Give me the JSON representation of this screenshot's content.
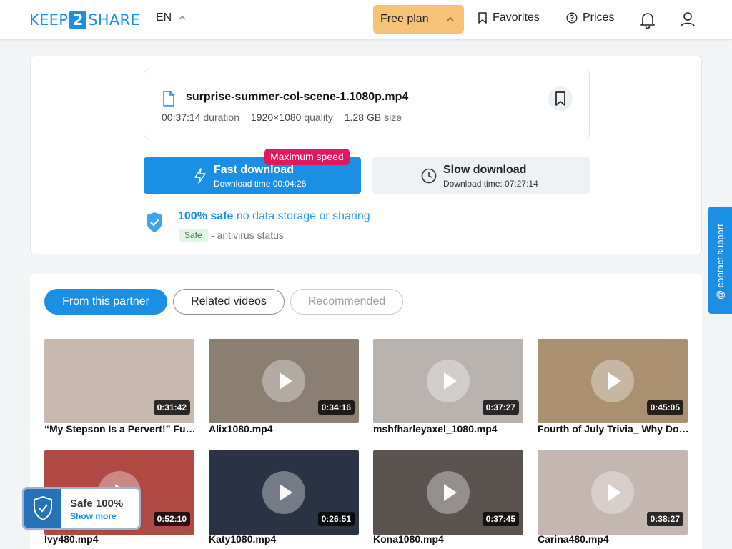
{
  "header": {
    "logo_pre": "KEEP",
    "logo_num": "2",
    "logo_post": "SHARE",
    "lang": "EN",
    "plan": "Free plan",
    "favorites": "Favorites",
    "prices": "Prices"
  },
  "file": {
    "name": "surprise-summer-col-scene-1.1080p.mp4",
    "duration_val": "00:37:14",
    "duration_label": "duration",
    "quality_val": "1920×1080",
    "quality_label": "quality",
    "size_val": "1.28 GB",
    "size_label": "size"
  },
  "download": {
    "fast_title": "Fast download",
    "fast_sub": "Download time 00:04:28",
    "badge": "Maximum speed",
    "slow_title": "Slow download",
    "slow_sub": "Download time: 07:27:14"
  },
  "safety": {
    "strong": "100% safe",
    "light": "no data storage or sharing",
    "tag": "Safe",
    "desc": "- antivirus status"
  },
  "tabs": [
    "From this partner",
    "Related videos",
    "Recommended"
  ],
  "videos": [
    {
      "title": "“My Stepson Is a Pervert!” Fuc…",
      "duration": "0:31:42",
      "bg": "#c9b8b0",
      "play": false
    },
    {
      "title": "Alix1080.mp4",
      "duration": "0:34:16",
      "bg": "#8a7f70",
      "play": true
    },
    {
      "title": "mshfharleyaxel_1080.mp4",
      "duration": "0:37:27",
      "bg": "#b9b3b0",
      "play": true
    },
    {
      "title": "Fourth of July Trivia_ Why Do Y…",
      "duration": "0:45:05",
      "bg": "#a89070",
      "play": true
    },
    {
      "title": "Ivy480.mp4",
      "duration": "0:52:10",
      "bg": "#b04a44",
      "play": true
    },
    {
      "title": "Katy1080.mp4",
      "duration": "0:26:51",
      "bg": "#2a3346",
      "play": true
    },
    {
      "title": "Kona1080.mp4",
      "duration": "0:37:45",
      "bg": "#5b5350",
      "play": true
    },
    {
      "title": "Carina480.mp4",
      "duration": "0:38:27",
      "bg": "#c4b6b0",
      "play": true
    }
  ],
  "contact": "@ contact support",
  "safe_widget": {
    "title": "Safe 100%",
    "link": "Show more"
  }
}
